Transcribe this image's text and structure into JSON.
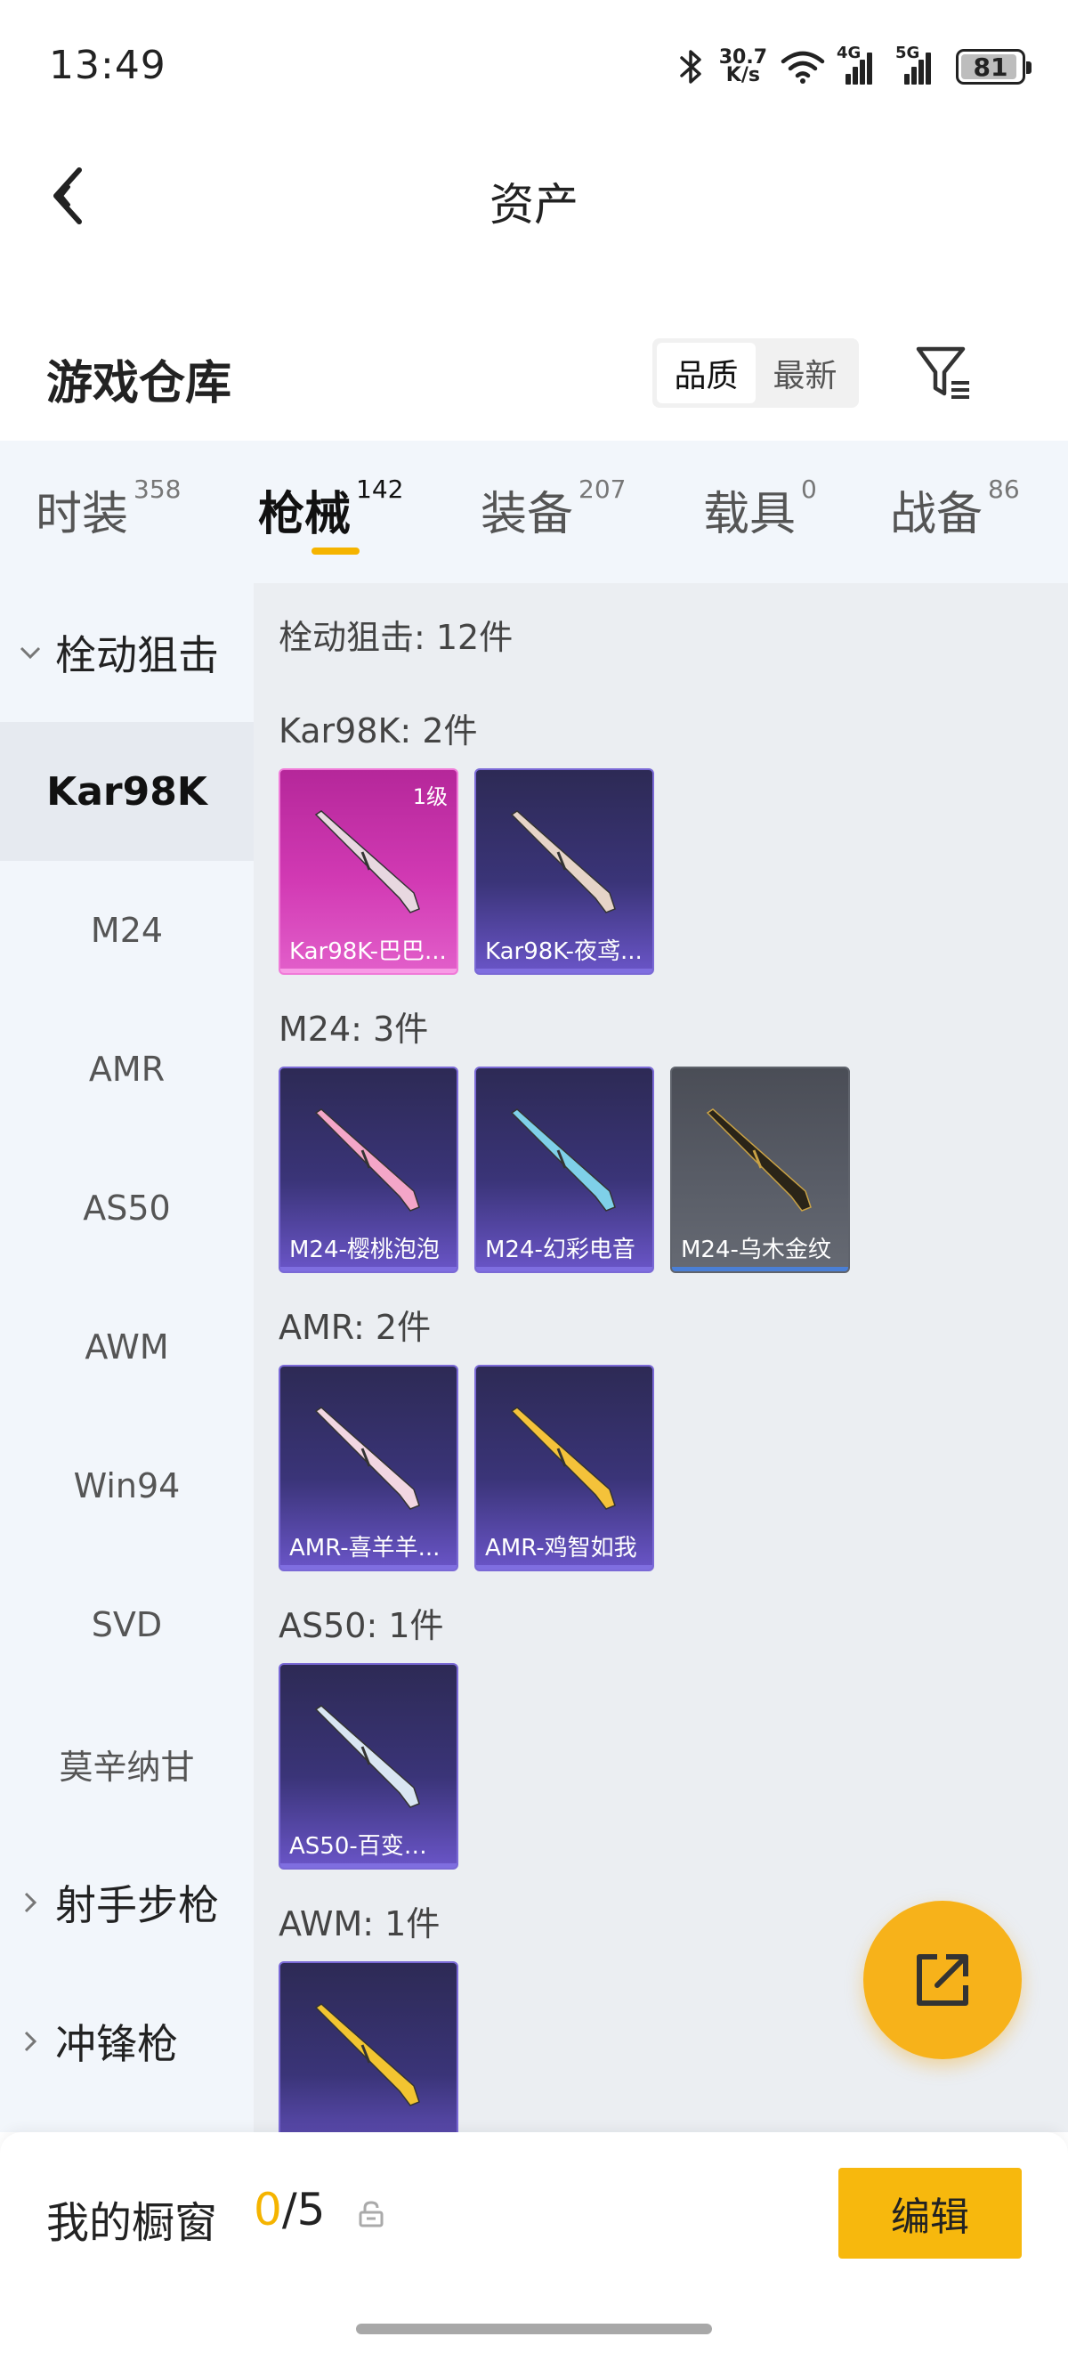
{
  "status_bar": {
    "time": "13:49",
    "net_speed_value": "30.7",
    "net_speed_unit": "K/s",
    "sim1": "4G",
    "sim2": "5G",
    "battery": "81"
  },
  "nav": {
    "title": "资产"
  },
  "warehouse": {
    "title": "游戏仓库",
    "sort_options": [
      "品质",
      "最新"
    ],
    "sort_active": "品质"
  },
  "tabs": [
    {
      "label": "时装",
      "count": "358"
    },
    {
      "label": "枪械",
      "count": "142"
    },
    {
      "label": "装备",
      "count": "207"
    },
    {
      "label": "载具",
      "count": "0"
    },
    {
      "label": "战备",
      "count": "86"
    }
  ],
  "active_tab": "枪械",
  "sidebar": {
    "items": [
      {
        "label": "栓动狙击",
        "type": "group-expanded"
      },
      {
        "label": "Kar98K",
        "type": "active"
      },
      {
        "label": "M24",
        "type": "item"
      },
      {
        "label": "AMR",
        "type": "item"
      },
      {
        "label": "AS50",
        "type": "item"
      },
      {
        "label": "AWM",
        "type": "item"
      },
      {
        "label": "Win94",
        "type": "item"
      },
      {
        "label": "SVD",
        "type": "item"
      },
      {
        "label": "莫辛纳甘",
        "type": "item"
      },
      {
        "label": "射手步枪",
        "type": "group-collapsed"
      },
      {
        "label": "冲锋枪",
        "type": "group-collapsed"
      }
    ]
  },
  "main": {
    "title": "栓动狙击: 12件",
    "sections": [
      {
        "title": "Kar98K: 2件",
        "cards": [
          {
            "name": "Kar98K-巴巴...",
            "level": "1级",
            "rarity": "pink",
            "gun_color": "#e8d8e0"
          },
          {
            "name": "Kar98K-夜鸢...",
            "level": "",
            "rarity": "purple",
            "gun_color": "#e6d4c8"
          }
        ]
      },
      {
        "title": "M24: 3件",
        "cards": [
          {
            "name": "M24-樱桃泡泡",
            "level": "",
            "rarity": "purple",
            "gun_color": "#f4a6c8"
          },
          {
            "name": "M24-幻彩电音",
            "level": "",
            "rarity": "purple",
            "gun_color": "#7fd0e8"
          },
          {
            "name": "M24-乌木金纹",
            "level": "",
            "rarity": "gray",
            "gun_color": "#2a2418"
          }
        ]
      },
      {
        "title": "AMR: 2件",
        "cards": [
          {
            "name": "AMR-喜羊羊...",
            "level": "",
            "rarity": "purple",
            "gun_color": "#f2d6e2"
          },
          {
            "name": "AMR-鸡智如我",
            "level": "",
            "rarity": "purple",
            "gun_color": "#f4c23a"
          }
        ]
      },
      {
        "title": "AS50: 1件",
        "cards": [
          {
            "name": "AS50-百变纱...",
            "level": "",
            "rarity": "purple",
            "gun_color": "#d9e6f2"
          }
        ]
      },
      {
        "title": "AWM: 1件",
        "cards": [
          {
            "name": "",
            "level": "",
            "rarity": "purple",
            "gun_color": "#f2c431"
          }
        ]
      }
    ]
  },
  "showcase": {
    "label": "我的橱窗",
    "current": "0",
    "separator": "/",
    "max": "5",
    "edit_label": "编辑"
  },
  "colors": {
    "accent": "#f7b80d",
    "fab": "#f7b21a",
    "sidebar_bg": "#f2f6fb",
    "content_bg": "#ebeef2"
  }
}
